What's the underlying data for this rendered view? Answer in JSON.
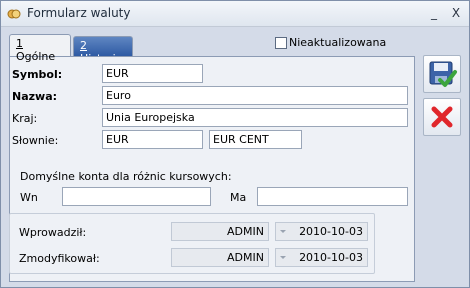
{
  "window": {
    "title": "Formularz waluty",
    "minimize_label": "_",
    "close_label": "X"
  },
  "tabs": [
    {
      "key": "1",
      "label": " Ogólne"
    },
    {
      "key": "2",
      "label": " Historia"
    }
  ],
  "outdated_checkbox": {
    "label": "Nieaktualizowana",
    "checked": false
  },
  "form": {
    "symbol_label": "Symbol:",
    "symbol_value": "EUR",
    "name_label": "Nazwa:",
    "name_value": "Euro",
    "country_label": "Kraj:",
    "country_value": "Unia Europejska",
    "verbal_label": "Słownie:",
    "verbal_main": "EUR",
    "verbal_sub": "EUR CENT"
  },
  "accounts": {
    "heading": "Domyślne konta dla różnic kursowych:",
    "wn_label": "Wn",
    "wn_value": "",
    "ma_label": "Ma",
    "ma_value": ""
  },
  "audit": {
    "entered_label": "Wprowadził:",
    "entered_user": "ADMIN",
    "entered_date": "2010-10-03",
    "modified_label": "Zmodyfikował:",
    "modified_user": "ADMIN",
    "modified_date": "2010-10-03"
  },
  "colors": {
    "accent": "#2e5aa3",
    "save_check": "#3da53d",
    "cancel": "#e0262b"
  },
  "icons": {
    "save": "save-disk-icon",
    "cancel": "cancel-x-icon"
  }
}
